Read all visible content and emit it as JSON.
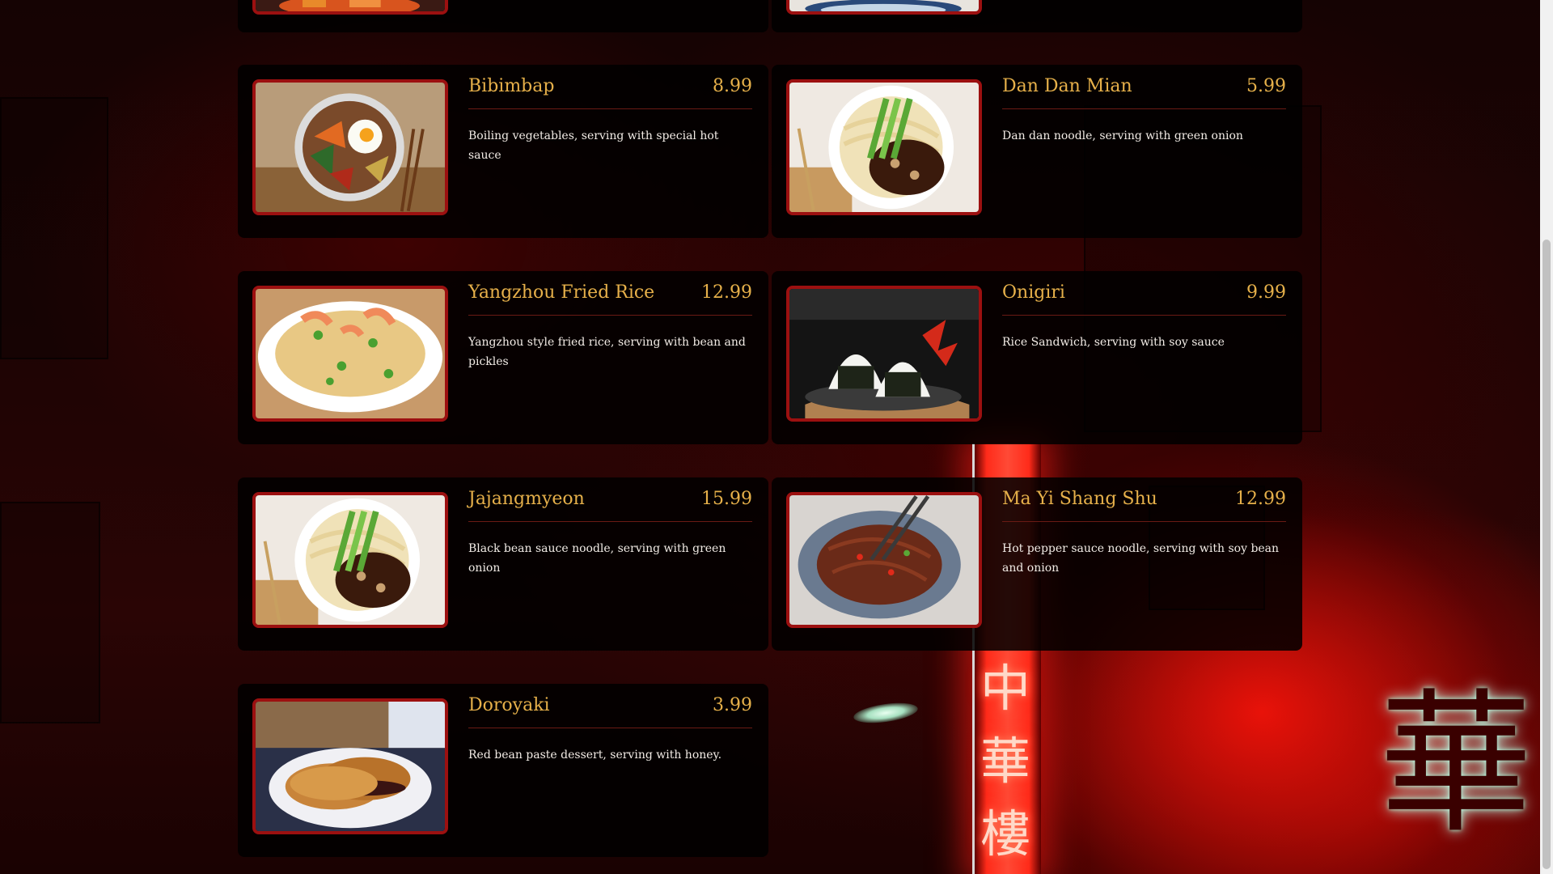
{
  "page": {
    "background_description_color": "#ff2b1a",
    "accent_color": "#e6b04a",
    "frame_color": "#9c1010"
  },
  "background_sign": {
    "vertical_chars": [
      "中",
      "華",
      "樓"
    ],
    "big_char": "華"
  },
  "menu": {
    "items": [
      {
        "name": "Bibimbap",
        "price": "8.99",
        "description": "Boiling vegetables, serving with special hot sauce",
        "image": "bibimbap-photo"
      },
      {
        "name": "Dan Dan Mian",
        "price": "5.99",
        "description": "Dan dan noodle, serving with green onion",
        "image": "dan-dan-mian-photo"
      },
      {
        "name": "Yangzhou Fried Rice",
        "price": "12.99",
        "description": "Yangzhou style fried rice, serving with bean and pickles",
        "image": "fried-rice-photo"
      },
      {
        "name": "Onigiri",
        "price": "9.99",
        "description": "Rice Sandwich, serving with soy sauce",
        "image": "onigiri-photo"
      },
      {
        "name": "Jajangmyeon",
        "price": "15.99",
        "description": "Black bean sauce noodle, serving with green onion",
        "image": "jajangmyeon-photo"
      },
      {
        "name": "Ma Yi Shang Shu",
        "price": "12.99",
        "description": "Hot pepper sauce noodle, serving with soy bean and onion",
        "image": "ma-yi-shang-shu-photo"
      },
      {
        "name": "Doroyaki",
        "price": "3.99",
        "description": "Red bean paste dessert, serving with honey.",
        "image": "doroyaki-photo"
      }
    ]
  }
}
